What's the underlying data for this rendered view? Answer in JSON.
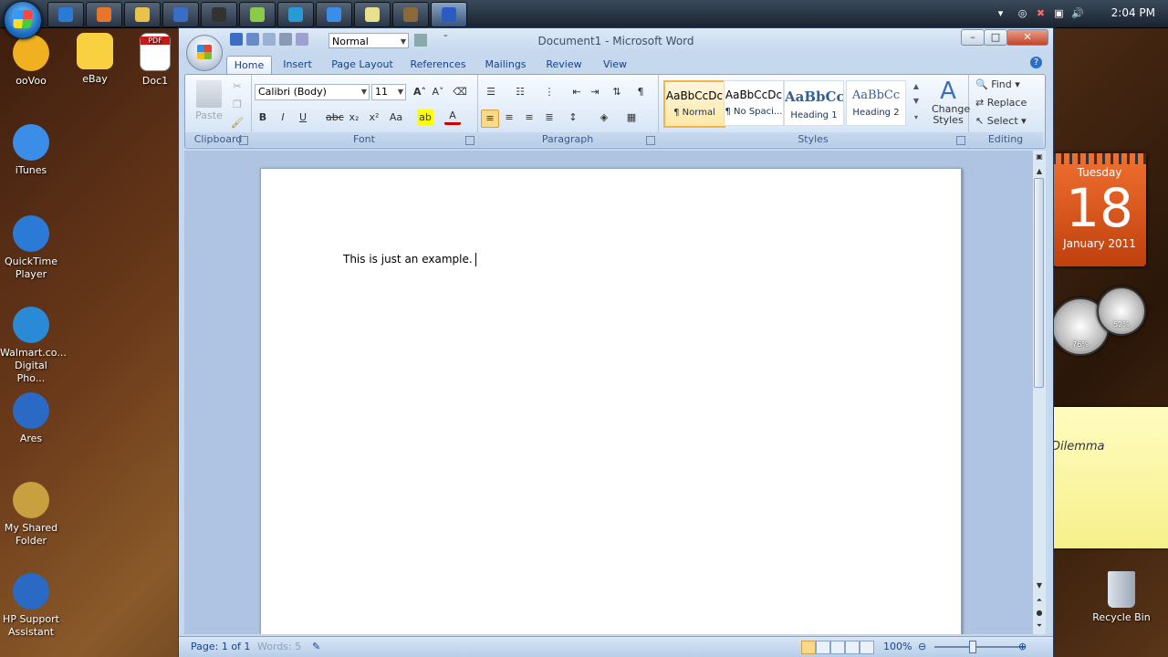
{
  "taskbar": {
    "clock": "2:04 PM",
    "buttons": [
      {
        "name": "ie",
        "color": "#2a7ad6"
      },
      {
        "name": "firefox",
        "color": "#e8762a"
      },
      {
        "name": "explorer",
        "color": "#e8c24a"
      },
      {
        "name": "email",
        "color": "#3a6ec4"
      },
      {
        "name": "media",
        "color": "#333"
      },
      {
        "name": "chat",
        "color": "#8acb4a"
      },
      {
        "name": "ares",
        "color": "#2a9ad6"
      },
      {
        "name": "itunes",
        "color": "#3a8ee8"
      },
      {
        "name": "notes",
        "color": "#e8e08a"
      },
      {
        "name": "tool",
        "color": "#8a6a3a"
      },
      {
        "name": "word",
        "color": "#2a5ac4"
      }
    ]
  },
  "desktop": {
    "icons": [
      {
        "label": "ooVoo",
        "color": "#f0b020"
      },
      {
        "label": "iTunes",
        "color": "#3a8ee8"
      },
      {
        "label": "QuickTime Player",
        "color": "#2a7ad6"
      },
      {
        "label": "Walmart.co... Digital Pho...",
        "color": "#2a8ad6"
      },
      {
        "label": "Ares",
        "color": "#2a6ac4"
      },
      {
        "label": "My Shared Folder",
        "color": "#c8a040"
      },
      {
        "label": "HP Support Assistant",
        "color": "#2a6ac4"
      }
    ],
    "icons_col2": [
      {
        "label": "eBay",
        "color": "#f8d040"
      },
      {
        "label": "Doc1",
        "color": "#c41a1a"
      }
    ],
    "recycle_bin": "Recycle Bin",
    "doc1_badge": "PDF"
  },
  "gadgets": {
    "calendar": {
      "day": "Tuesday",
      "date": "18",
      "month": "January 2011"
    },
    "gauge_cpu": "76%",
    "gauge_mem": "52%",
    "note_text": "Dilemma"
  },
  "word": {
    "title": "Document1 - Microsoft Word",
    "style_combo": "Normal",
    "tabs": [
      "Home",
      "Insert",
      "Page Layout",
      "References",
      "Mailings",
      "Review",
      "View"
    ],
    "active_tab": "Home",
    "groups": {
      "clipboard": "Clipboard",
      "font": "Font",
      "paragraph": "Paragraph",
      "styles": "Styles",
      "editing": "Editing"
    },
    "clipboard": {
      "paste": "Paste"
    },
    "font": {
      "family": "Calibri (Body)",
      "size": "11"
    },
    "styles": [
      {
        "preview": "AaBbCcDc",
        "name": "¶ Normal",
        "selected": true
      },
      {
        "preview": "AaBbCcDc",
        "name": "¶ No Spaci...",
        "selected": false
      },
      {
        "preview": "AaBbCc",
        "name": "Heading 1",
        "selected": false
      },
      {
        "preview": "AaBbCc",
        "name": "Heading 2",
        "selected": false
      }
    ],
    "change_styles": "Change Styles",
    "editing": {
      "find": "Find",
      "replace": "Replace",
      "select": "Select"
    },
    "document_text": "This is just an example.",
    "status": {
      "page": "Page: 1 of 1",
      "words": "Words: 5",
      "zoom": "100%"
    },
    "window_controls": {
      "minimize": "–",
      "maximize": "□",
      "close": "✕"
    }
  }
}
